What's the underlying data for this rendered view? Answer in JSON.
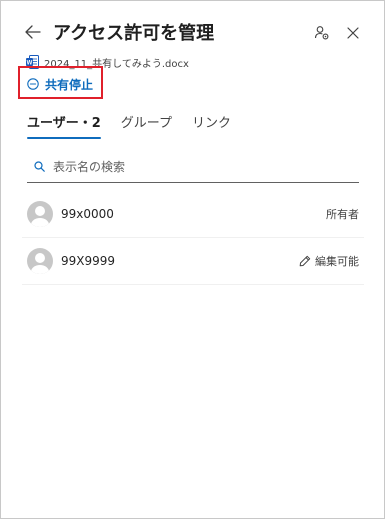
{
  "header": {
    "title": "アクセス許可を管理",
    "back_icon": "arrow-left-icon",
    "settings_icon": "people-settings-icon",
    "close_icon": "close-icon"
  },
  "file": {
    "icon": "word-document-icon",
    "name": "2024_11_共有してみよう.docx"
  },
  "stop_sharing": {
    "label": "共有停止",
    "icon": "minus-circle-icon",
    "highlight_color": "#e0202b"
  },
  "tabs": [
    {
      "label": "ユーザー・2",
      "active": true
    },
    {
      "label": "グループ",
      "active": false
    },
    {
      "label": "リンク",
      "active": false
    }
  ],
  "search": {
    "placeholder": "表示名の検索",
    "value": ""
  },
  "users": [
    {
      "name": "99x0000",
      "role": "所有者",
      "role_icon": ""
    },
    {
      "name": "99X9999",
      "role": "編集可能",
      "role_icon": "pencil-icon"
    }
  ],
  "colors": {
    "accent": "#0f6cbd",
    "avatar_bg": "#c7c7c7"
  }
}
